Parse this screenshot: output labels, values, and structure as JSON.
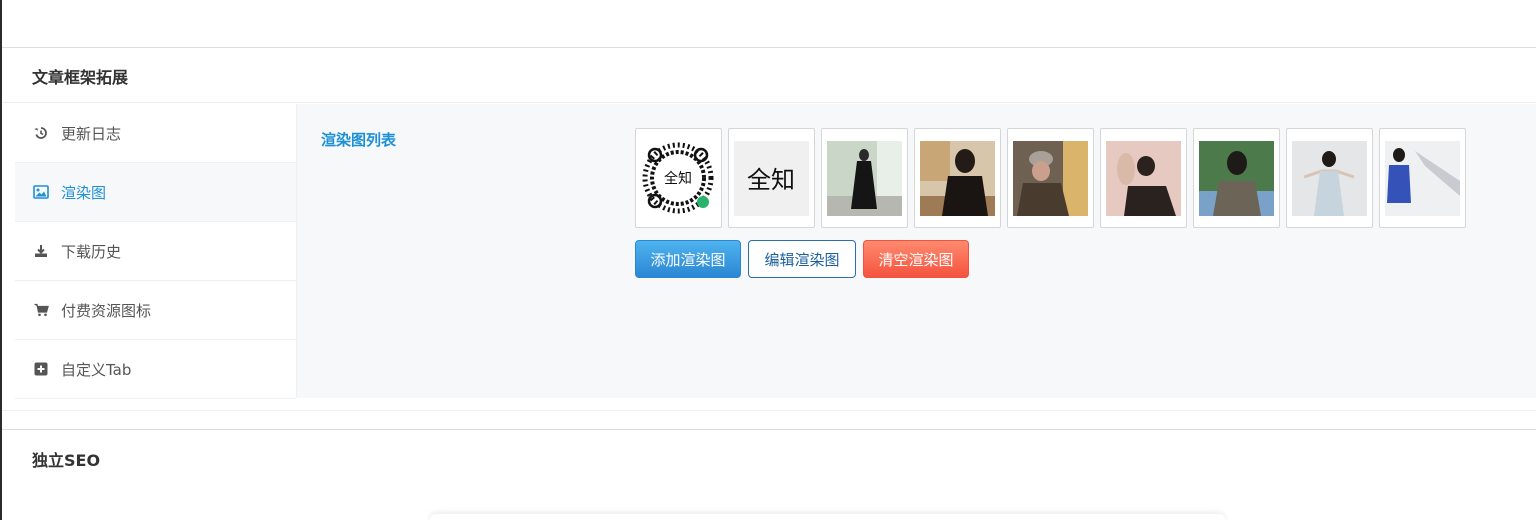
{
  "panel": {
    "title": "文章框架拓展"
  },
  "sidebar": {
    "items": [
      {
        "label": "更新日志",
        "icon": "history-icon"
      },
      {
        "label": "渲染图",
        "icon": "image-icon",
        "active": true
      },
      {
        "label": "下载历史",
        "icon": "download-icon"
      },
      {
        "label": "付费资源图标",
        "icon": "cart-icon"
      },
      {
        "label": "自定义Tab",
        "icon": "plus-square-icon"
      }
    ]
  },
  "content": {
    "field_label": "渲染图列表",
    "thumbnails": [
      {
        "name": "qr-code-image"
      },
      {
        "name": "logo-image"
      },
      {
        "name": "photo-1"
      },
      {
        "name": "photo-2"
      },
      {
        "name": "photo-3"
      },
      {
        "name": "photo-4"
      },
      {
        "name": "photo-5"
      },
      {
        "name": "photo-6"
      },
      {
        "name": "photo-7"
      }
    ],
    "buttons": {
      "add": "添加渲染图",
      "edit": "编辑渲染图",
      "clear": "清空渲染图"
    }
  },
  "section2": {
    "title": "独立SEO"
  },
  "colors": {
    "accent": "#1e90d6",
    "danger": "#f5533f"
  }
}
